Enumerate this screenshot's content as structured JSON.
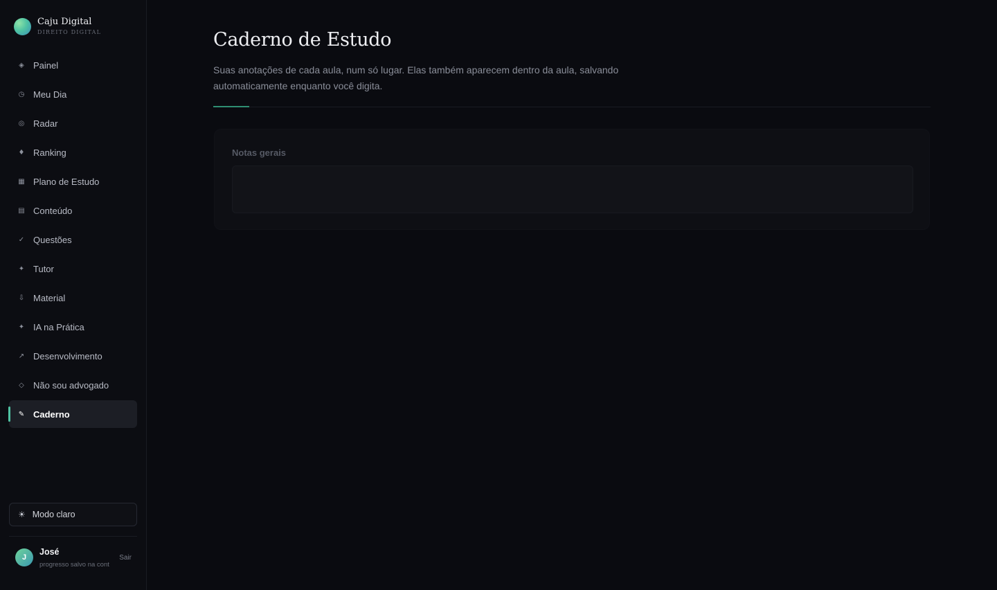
{
  "brand": {
    "name": "Caju Digital",
    "subtitle": "DIREITO DIGITAL"
  },
  "sidebar": {
    "items": [
      {
        "label": "Painel",
        "icon": "◈",
        "icon_name": "diamond-grid-icon"
      },
      {
        "label": "Meu Dia",
        "icon": "◷",
        "icon_name": "clock-icon"
      },
      {
        "label": "Radar",
        "icon": "◎",
        "icon_name": "radar-icon"
      },
      {
        "label": "Ranking",
        "icon": "♦",
        "icon_name": "diamond-icon"
      },
      {
        "label": "Plano de Estudo",
        "icon": "▦",
        "icon_name": "grid-icon"
      },
      {
        "label": "Conteúdo",
        "icon": "▤",
        "icon_name": "list-icon"
      },
      {
        "label": "Questões",
        "icon": "✓",
        "icon_name": "check-icon"
      },
      {
        "label": "Tutor",
        "icon": "✦",
        "icon_name": "sparkle-icon"
      },
      {
        "label": "Material",
        "icon": "⇩",
        "icon_name": "download-icon"
      },
      {
        "label": "IA na Prática",
        "icon": "✦",
        "icon_name": "sparkle-icon"
      },
      {
        "label": "Desenvolvimento",
        "icon": "↗",
        "icon_name": "arrow-up-right-icon"
      },
      {
        "label": "Não sou advogado",
        "icon": "◇",
        "icon_name": "diamond-outline-icon"
      },
      {
        "label": "Caderno",
        "icon": "✎",
        "icon_name": "pencil-icon",
        "active": true
      }
    ],
    "theme_toggle": {
      "label": "Modo claro",
      "icon": "☀"
    },
    "user": {
      "initial": "J",
      "name": "José",
      "status": "progresso salvo na cont",
      "logout": "Sair"
    }
  },
  "main": {
    "title": "Caderno de Estudo",
    "description": "Suas anotações de cada aula, num só lugar. Elas também aparecem dentro da aula, salvando automaticamente enquanto você digita.",
    "notes_card": {
      "label": "Notas gerais",
      "value": ""
    }
  },
  "colors": {
    "background": "#0a0b10",
    "accent": "#4fc3a3",
    "active_item_bg": "#1c1e25"
  }
}
